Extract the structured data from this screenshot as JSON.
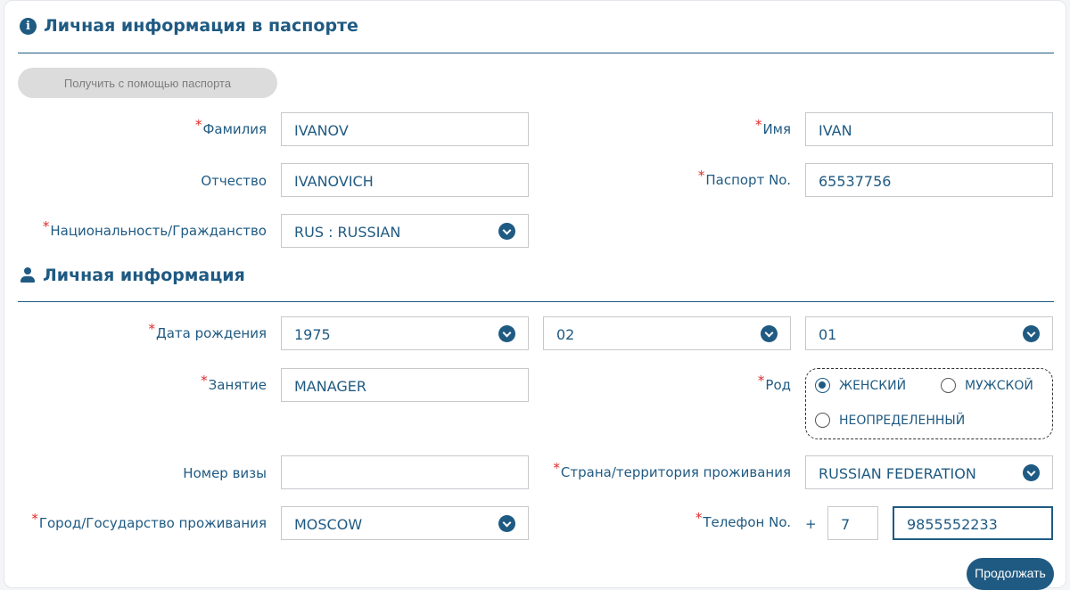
{
  "passport_section": {
    "title": "Личная информация в паспорте",
    "icon": "info-icon",
    "fill_button_label": "Получить с помощью паспорта",
    "surname": {
      "label": "Фамилия",
      "value": "IVANOV",
      "required": true
    },
    "given_name": {
      "label": "Имя",
      "value": "IVAN",
      "required": true
    },
    "patronymic": {
      "label": "Отчество",
      "value": "IVANOVICH",
      "required": false
    },
    "passport_no": {
      "label": "Паспорт No.",
      "value": "65537756",
      "required": true
    },
    "nationality": {
      "label": "Национальность/Гражданство",
      "value": "RUS : RUSSIAN",
      "required": true
    }
  },
  "personal_section": {
    "title": "Личная информация",
    "icon": "person-icon",
    "birth_date": {
      "label": "Дата рождения",
      "year": "1975",
      "month": "02",
      "day": "01",
      "required": true
    },
    "occupation": {
      "label": "Занятие",
      "value": "MANAGER",
      "required": true
    },
    "gender": {
      "label": "Род",
      "required": true,
      "options": [
        "ЖЕНСКИЙ",
        "МУЖСКОЙ",
        "НЕОПРЕДЕЛЕННЫЙ"
      ],
      "selected": "ЖЕНСКИЙ"
    },
    "visa_number": {
      "label": "Номер визы",
      "value": "",
      "required": false
    },
    "residence_country": {
      "label": "Страна/территория проживания",
      "value": "RUSSIAN FEDERATION",
      "required": true
    },
    "residence_city": {
      "label": "Город/Государство проживания",
      "value": "MOSCOW",
      "required": true
    },
    "phone": {
      "label": "Телефон No.",
      "plus": "+",
      "country_code": "7",
      "number": "9855552233",
      "required": true
    }
  },
  "continue_button_label": "Продолжать",
  "colors": {
    "accent": "#1f5a82",
    "required_star": "#e02a2a",
    "disabled_button": "#dcdcdc"
  }
}
